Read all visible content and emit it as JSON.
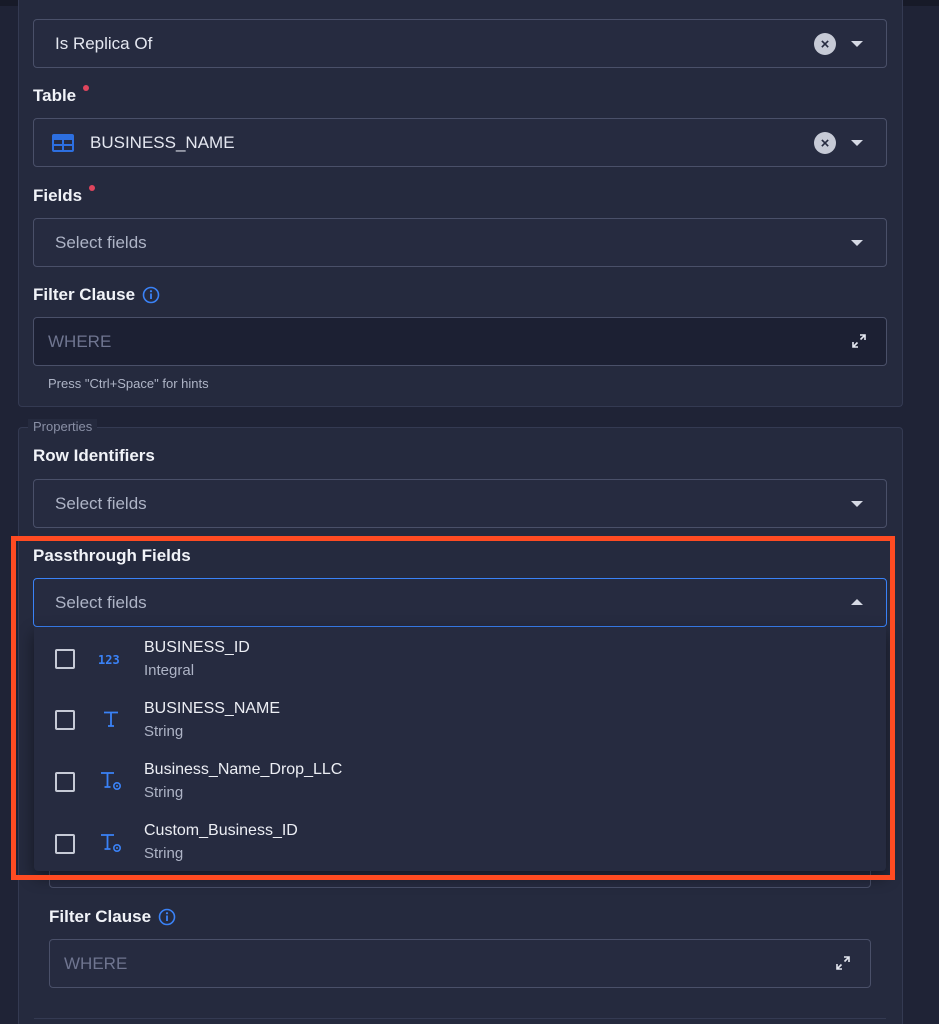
{
  "replica_select": {
    "value": "Is Replica Of"
  },
  "table": {
    "label": "Table",
    "value": "BUSINESS_NAME"
  },
  "fields": {
    "label": "Fields",
    "placeholder": "Select fields"
  },
  "filter_clause": {
    "label": "Filter Clause",
    "placeholder": "WHERE",
    "hint": "Press \"Ctrl+Space\" for hints"
  },
  "properties": {
    "legend": "Properties",
    "row_identifiers": {
      "label": "Row Identifiers",
      "placeholder": "Select fields"
    },
    "passthrough_fields": {
      "label": "Passthrough Fields",
      "placeholder": "Select fields",
      "options": [
        {
          "name": "BUSINESS_ID",
          "type": "Integral",
          "icon": "integer-type-icon"
        },
        {
          "name": "BUSINESS_NAME",
          "type": "String",
          "icon": "string-type-icon"
        },
        {
          "name": "Business_Name_Drop_LLC",
          "type": "String",
          "icon": "derived-string-type-icon"
        },
        {
          "name": "Custom_Business_ID",
          "type": "String",
          "icon": "derived-string-type-icon"
        }
      ]
    },
    "filter_clause": {
      "label": "Filter Clause",
      "placeholder": "WHERE"
    }
  },
  "colors": {
    "accent": "#3a82f7",
    "highlight": "#ff4b22",
    "required": "#e0455d"
  }
}
